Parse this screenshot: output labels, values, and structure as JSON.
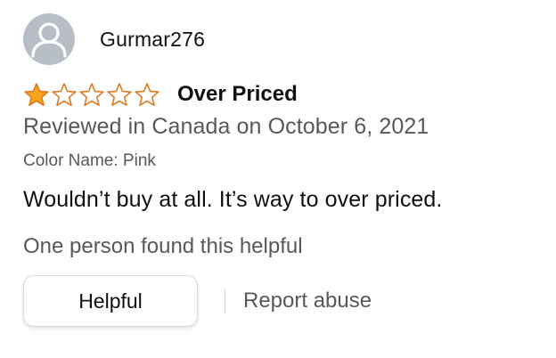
{
  "review": {
    "profile": {
      "name": "Gurmar276",
      "avatar_icon": "user-silhouette-icon"
    },
    "rating": {
      "value": 1,
      "max": 5,
      "filled_color": "#f7a51d",
      "empty_color": "#de7921"
    },
    "title": "Over Priced",
    "date_line": "Reviewed in Canada on October 6, 2021",
    "variant": "Color Name: Pink",
    "body": "Wouldn’t buy at all. It’s way to over priced.",
    "helpful_count": "One person found this helpful",
    "actions": {
      "helpful_label": "Helpful",
      "report_label": "Report abuse"
    }
  }
}
